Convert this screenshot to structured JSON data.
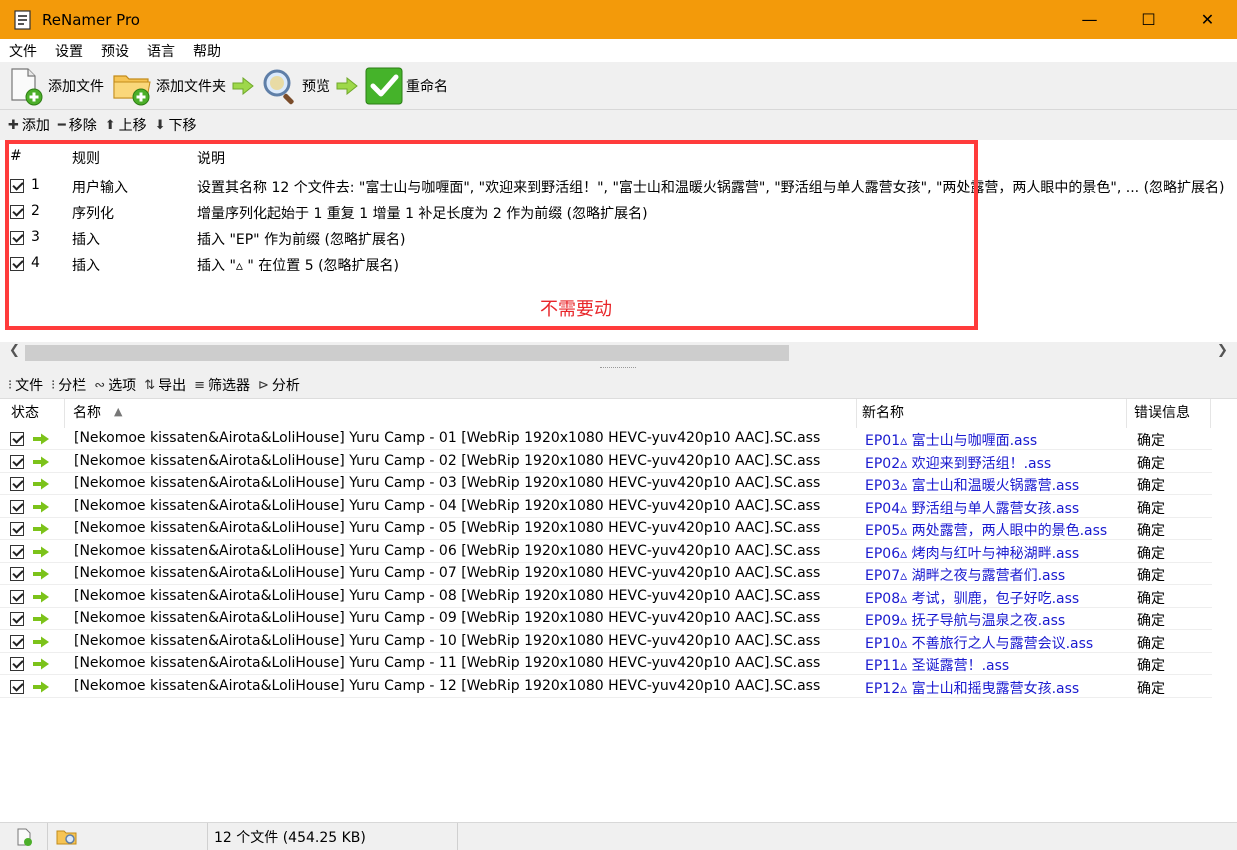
{
  "window": {
    "title": "ReNamer Pro",
    "minimize": "—",
    "maximize": "☐",
    "close": "✕"
  },
  "menu": [
    "文件",
    "设置",
    "预设",
    "语言",
    "帮助"
  ],
  "toolbar": {
    "add_files": "添加文件",
    "add_folder": "添加文件夹",
    "preview": "预览",
    "rename": "重命名"
  },
  "rules_toolbar": {
    "add": "添加",
    "remove": "移除",
    "up": "上移",
    "down": "下移"
  },
  "rules": {
    "headers": {
      "num": "#",
      "rule": "规则",
      "desc": "说明"
    },
    "rows": [
      {
        "num": "1",
        "rule": "用户输入",
        "desc": "设置其名称 12 个文件去: \"富士山与咖喱面\", \"欢迎来到野活组！\", \"富士山和温暖火锅露营\", \"野活组与单人露营女孩\", \"两处露营，两人眼中的景色\", ... (忽略扩展名)"
      },
      {
        "num": "2",
        "rule": "序列化",
        "desc": "增量序列化起始于 1 重复 1 增量 1 补足长度为 2 作为前缀 (忽略扩展名)"
      },
      {
        "num": "3",
        "rule": "插入",
        "desc": "插入 \"EP\" 作为前缀 (忽略扩展名)"
      },
      {
        "num": "4",
        "rule": "插入",
        "desc": "插入 \"▵ \" 在位置 5 (忽略扩展名)"
      }
    ],
    "annotation": "不需要动"
  },
  "files_toolbar": {
    "files": "文件",
    "columns": "分栏",
    "options": "选项",
    "export": "导出",
    "filter": "筛选器",
    "analyze": "分析"
  },
  "files": {
    "headers": {
      "status": "状态",
      "name": "名称",
      "new_name": "新名称",
      "error": "错误信息"
    },
    "rows": [
      {
        "name": "[Nekomoe kissaten&Airota&LoliHouse] Yuru Camp - 01 [WebRip 1920x1080 HEVC-yuv420p10 AAC].SC.ass",
        "new_name": "EP01▵ 富士山与咖喱面.ass",
        "error": "确定"
      },
      {
        "name": "[Nekomoe kissaten&Airota&LoliHouse] Yuru Camp - 02 [WebRip 1920x1080 HEVC-yuv420p10 AAC].SC.ass",
        "new_name": "EP02▵ 欢迎来到野活组！.ass",
        "error": "确定"
      },
      {
        "name": "[Nekomoe kissaten&Airota&LoliHouse] Yuru Camp - 03 [WebRip 1920x1080 HEVC-yuv420p10 AAC].SC.ass",
        "new_name": "EP03▵ 富士山和温暖火锅露营.ass",
        "error": "确定"
      },
      {
        "name": "[Nekomoe kissaten&Airota&LoliHouse] Yuru Camp - 04 [WebRip 1920x1080 HEVC-yuv420p10 AAC].SC.ass",
        "new_name": "EP04▵ 野活组与单人露营女孩.ass",
        "error": "确定"
      },
      {
        "name": "[Nekomoe kissaten&Airota&LoliHouse] Yuru Camp - 05 [WebRip 1920x1080 HEVC-yuv420p10 AAC].SC.ass",
        "new_name": "EP05▵ 两处露营，两人眼中的景色.ass",
        "error": "确定"
      },
      {
        "name": "[Nekomoe kissaten&Airota&LoliHouse] Yuru Camp - 06 [WebRip 1920x1080 HEVC-yuv420p10 AAC].SC.ass",
        "new_name": "EP06▵ 烤肉与红叶与神秘湖畔.ass",
        "error": "确定"
      },
      {
        "name": "[Nekomoe kissaten&Airota&LoliHouse] Yuru Camp - 07 [WebRip 1920x1080 HEVC-yuv420p10 AAC].SC.ass",
        "new_name": "EP07▵ 湖畔之夜与露营者们.ass",
        "error": "确定"
      },
      {
        "name": "[Nekomoe kissaten&Airota&LoliHouse] Yuru Camp - 08 [WebRip 1920x1080 HEVC-yuv420p10 AAC].SC.ass",
        "new_name": "EP08▵ 考试，驯鹿，包子好吃.ass",
        "error": "确定"
      },
      {
        "name": "[Nekomoe kissaten&Airota&LoliHouse] Yuru Camp - 09 [WebRip 1920x1080 HEVC-yuv420p10 AAC].SC.ass",
        "new_name": "EP09▵ 抚子导航与温泉之夜.ass",
        "error": "确定"
      },
      {
        "name": "[Nekomoe kissaten&Airota&LoliHouse] Yuru Camp - 10 [WebRip 1920x1080 HEVC-yuv420p10 AAC].SC.ass",
        "new_name": "EP10▵ 不善旅行之人与露营会议.ass",
        "error": "确定"
      },
      {
        "name": "[Nekomoe kissaten&Airota&LoliHouse] Yuru Camp - 11 [WebRip 1920x1080 HEVC-yuv420p10 AAC].SC.ass",
        "new_name": "EP11▵ 圣诞露营！.ass",
        "error": "确定"
      },
      {
        "name": "[Nekomoe kissaten&Airota&LoliHouse] Yuru Camp - 12 [WebRip 1920x1080 HEVC-yuv420p10 AAC].SC.ass",
        "new_name": "EP12▵ 富士山和摇曳露营女孩.ass",
        "error": "确定"
      }
    ]
  },
  "status": {
    "summary": "12 个文件 (454.25 KB)"
  },
  "colors": {
    "titlebar": "#f39a0a",
    "highlight_box": "#ff3b3b",
    "annotation": "#e8262a",
    "new_name": "#1a1ad0",
    "arrow": "#7cc31a"
  }
}
